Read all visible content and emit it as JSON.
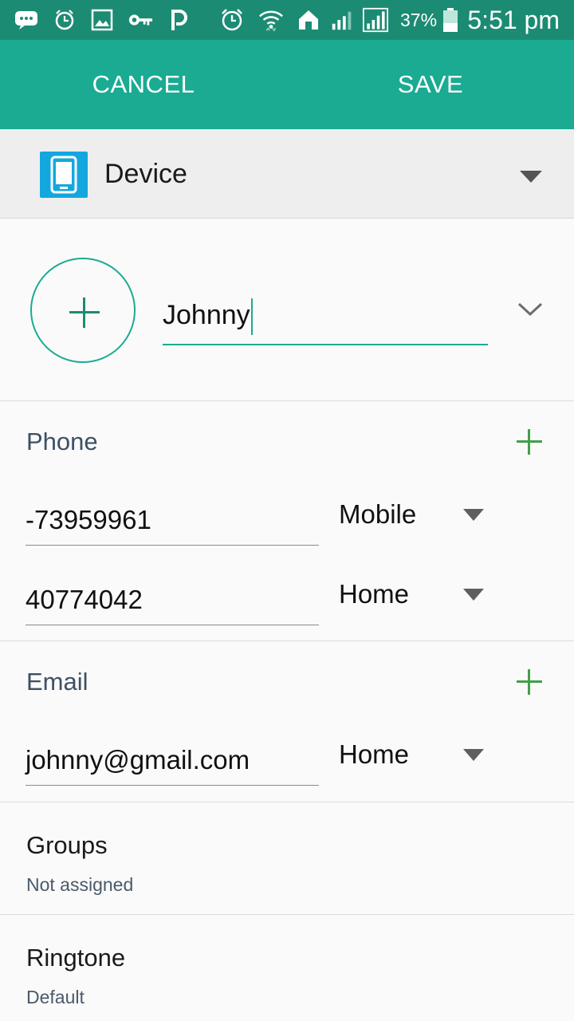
{
  "status_bar": {
    "battery_percent": "37%",
    "time": "5:51 pm",
    "icons": [
      "message-icon",
      "alarm-icon",
      "image-icon",
      "key-icon",
      "p-icon",
      "alarm-clock-icon",
      "wifi-icon",
      "home-icon",
      "signal-icon",
      "signal-icon",
      "battery-icon"
    ]
  },
  "action_bar": {
    "cancel_label": "CANCEL",
    "save_label": "SAVE"
  },
  "account": {
    "label": "Device",
    "icon": "device-icon",
    "icon_color": "#14a7df"
  },
  "name": {
    "value": "Johnny"
  },
  "phone": {
    "title": "Phone",
    "entries": [
      {
        "value": "-73959961",
        "type": "Mobile"
      },
      {
        "value": "40774042",
        "type": "Home"
      }
    ]
  },
  "email": {
    "title": "Email",
    "entries": [
      {
        "value": "johnny@gmail.com",
        "type": "Home"
      }
    ]
  },
  "groups": {
    "title": "Groups",
    "value": "Not assigned"
  },
  "ringtone": {
    "title": "Ringtone",
    "value": "Default"
  },
  "colors": {
    "status_bar": "#1c8b73",
    "action_bar": "#1aab92",
    "accent": "#1aab92",
    "add_green": "#43a047"
  }
}
